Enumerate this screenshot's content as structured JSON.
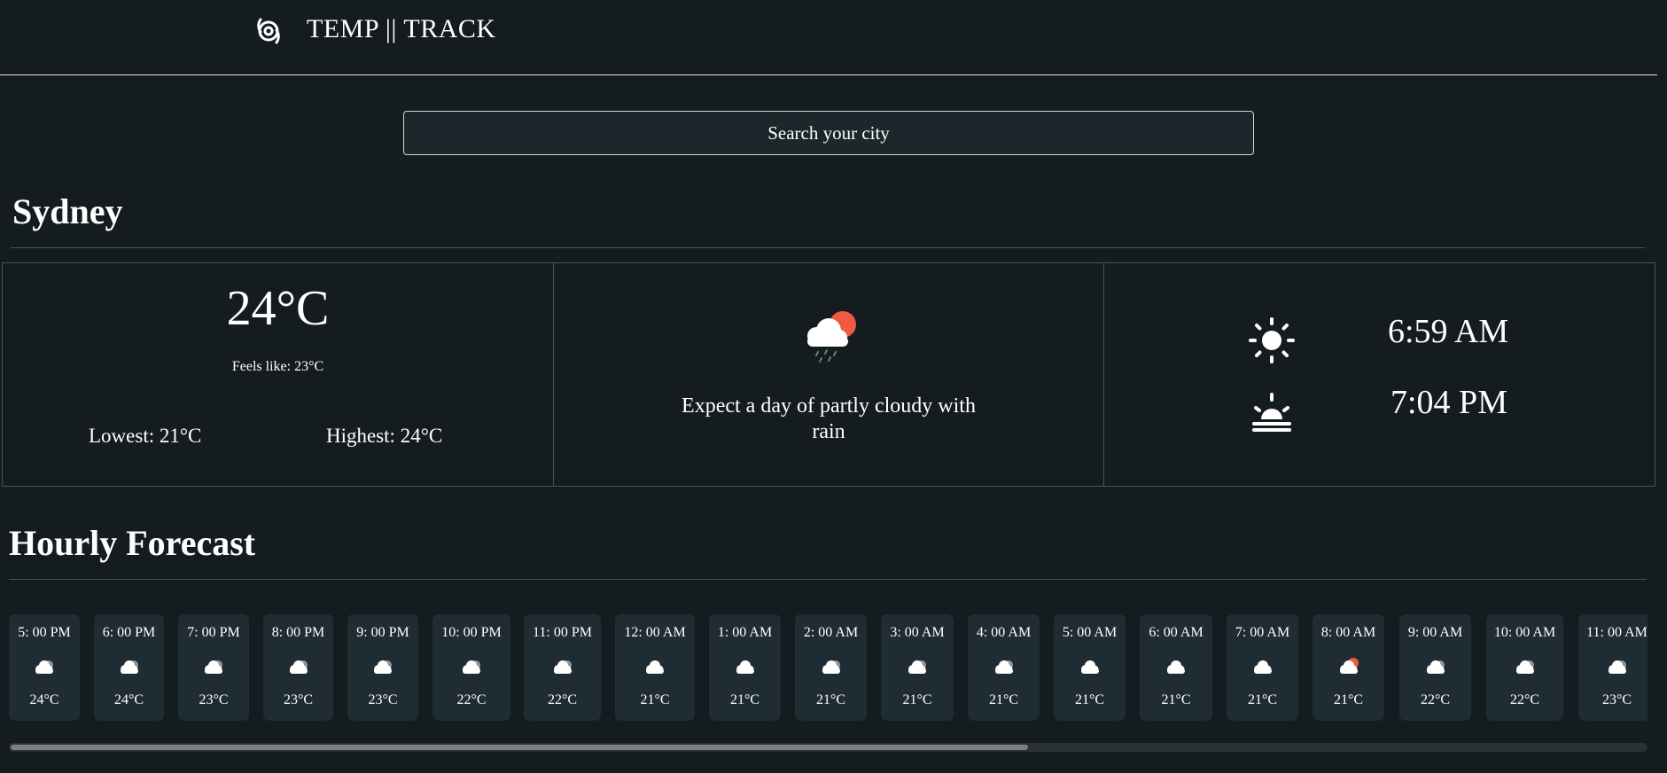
{
  "header": {
    "title": "TEMP || TRACK",
    "logo_icon": "cyclone-icon"
  },
  "search": {
    "placeholder": "Search your city",
    "value": ""
  },
  "city": {
    "name": "Sydney"
  },
  "current": {
    "temperature": "24°C",
    "feels_like": "Feels like: 23°C",
    "lowest": "Lowest: 21°C",
    "highest": "Highest: 24°C",
    "condition_icon": "partly-cloudy-rain-icon",
    "condition_text": "Expect a day of partly cloudy with rain",
    "sunrise_icon": "sunrise-icon",
    "sunrise": "6:59 AM",
    "sunset_icon": "sunset-icon",
    "sunset": "7:04 PM"
  },
  "hourly": {
    "title": "Hourly Forecast",
    "items": [
      {
        "time": "5: 00 PM",
        "temp": "24°C",
        "icon": "cloud-night-icon"
      },
      {
        "time": "6: 00 PM",
        "temp": "24°C",
        "icon": "cloud-night-icon"
      },
      {
        "time": "7: 00 PM",
        "temp": "23°C",
        "icon": "cloud-night-icon"
      },
      {
        "time": "8: 00 PM",
        "temp": "23°C",
        "icon": "cloud-night-icon"
      },
      {
        "time": "9: 00 PM",
        "temp": "23°C",
        "icon": "cloud-night-icon"
      },
      {
        "time": "10: 00 PM",
        "temp": "22°C",
        "icon": "cloud-night-icon"
      },
      {
        "time": "11: 00 PM",
        "temp": "22°C",
        "icon": "cloud-night-icon"
      },
      {
        "time": "12: 00 AM",
        "temp": "21°C",
        "icon": "cloud-icon"
      },
      {
        "time": "1: 00 AM",
        "temp": "21°C",
        "icon": "cloud-icon"
      },
      {
        "time": "2: 00 AM",
        "temp": "21°C",
        "icon": "cloud-night-icon"
      },
      {
        "time": "3: 00 AM",
        "temp": "21°C",
        "icon": "cloud-night-icon"
      },
      {
        "time": "4: 00 AM",
        "temp": "21°C",
        "icon": "cloud-night-icon"
      },
      {
        "time": "5: 00 AM",
        "temp": "21°C",
        "icon": "cloud-icon"
      },
      {
        "time": "6: 00 AM",
        "temp": "21°C",
        "icon": "cloud-icon"
      },
      {
        "time": "7: 00 AM",
        "temp": "21°C",
        "icon": "cloud-icon"
      },
      {
        "time": "8: 00 AM",
        "temp": "21°C",
        "icon": "cloud-sun-icon"
      },
      {
        "time": "9: 00 AM",
        "temp": "22°C",
        "icon": "cloud-night-icon"
      },
      {
        "time": "10: 00 AM",
        "temp": "22°C",
        "icon": "cloud-night-icon"
      },
      {
        "time": "11: 00 AM",
        "temp": "23°C",
        "icon": "cloud-night-icon"
      }
    ]
  },
  "scrollbar": {
    "position": 0,
    "visible_fraction": 0.62
  },
  "colors": {
    "background": "#151c1f",
    "card": "#1f2c33",
    "accent_sun": "#f05a40"
  }
}
